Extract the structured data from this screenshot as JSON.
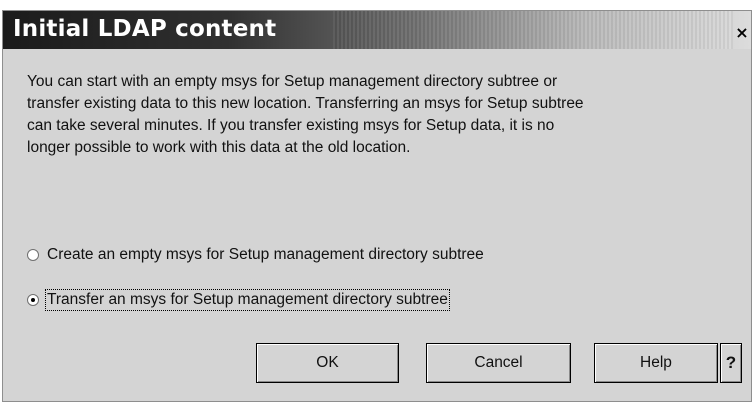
{
  "dialog": {
    "title": "Initial LDAP content",
    "close_label": "×",
    "message_lines": [
      "You can start with an empty msys for Setup management directory subtree or",
      "transfer existing data to this new location. Transferring an msys for Setup subtree",
      "can take several minutes. If you transfer existing msys for Setup data, it is no",
      "longer possible to work with this data at the old location."
    ]
  },
  "options": {
    "create": {
      "label": "Create an empty msys for Setup management directory subtree",
      "selected": false
    },
    "transfer": {
      "label": "Transfer an msys for Setup management directory subtree",
      "selected": true
    }
  },
  "buttons": {
    "ok": "OK",
    "cancel": "Cancel",
    "help": "Help",
    "context_help": "?"
  }
}
